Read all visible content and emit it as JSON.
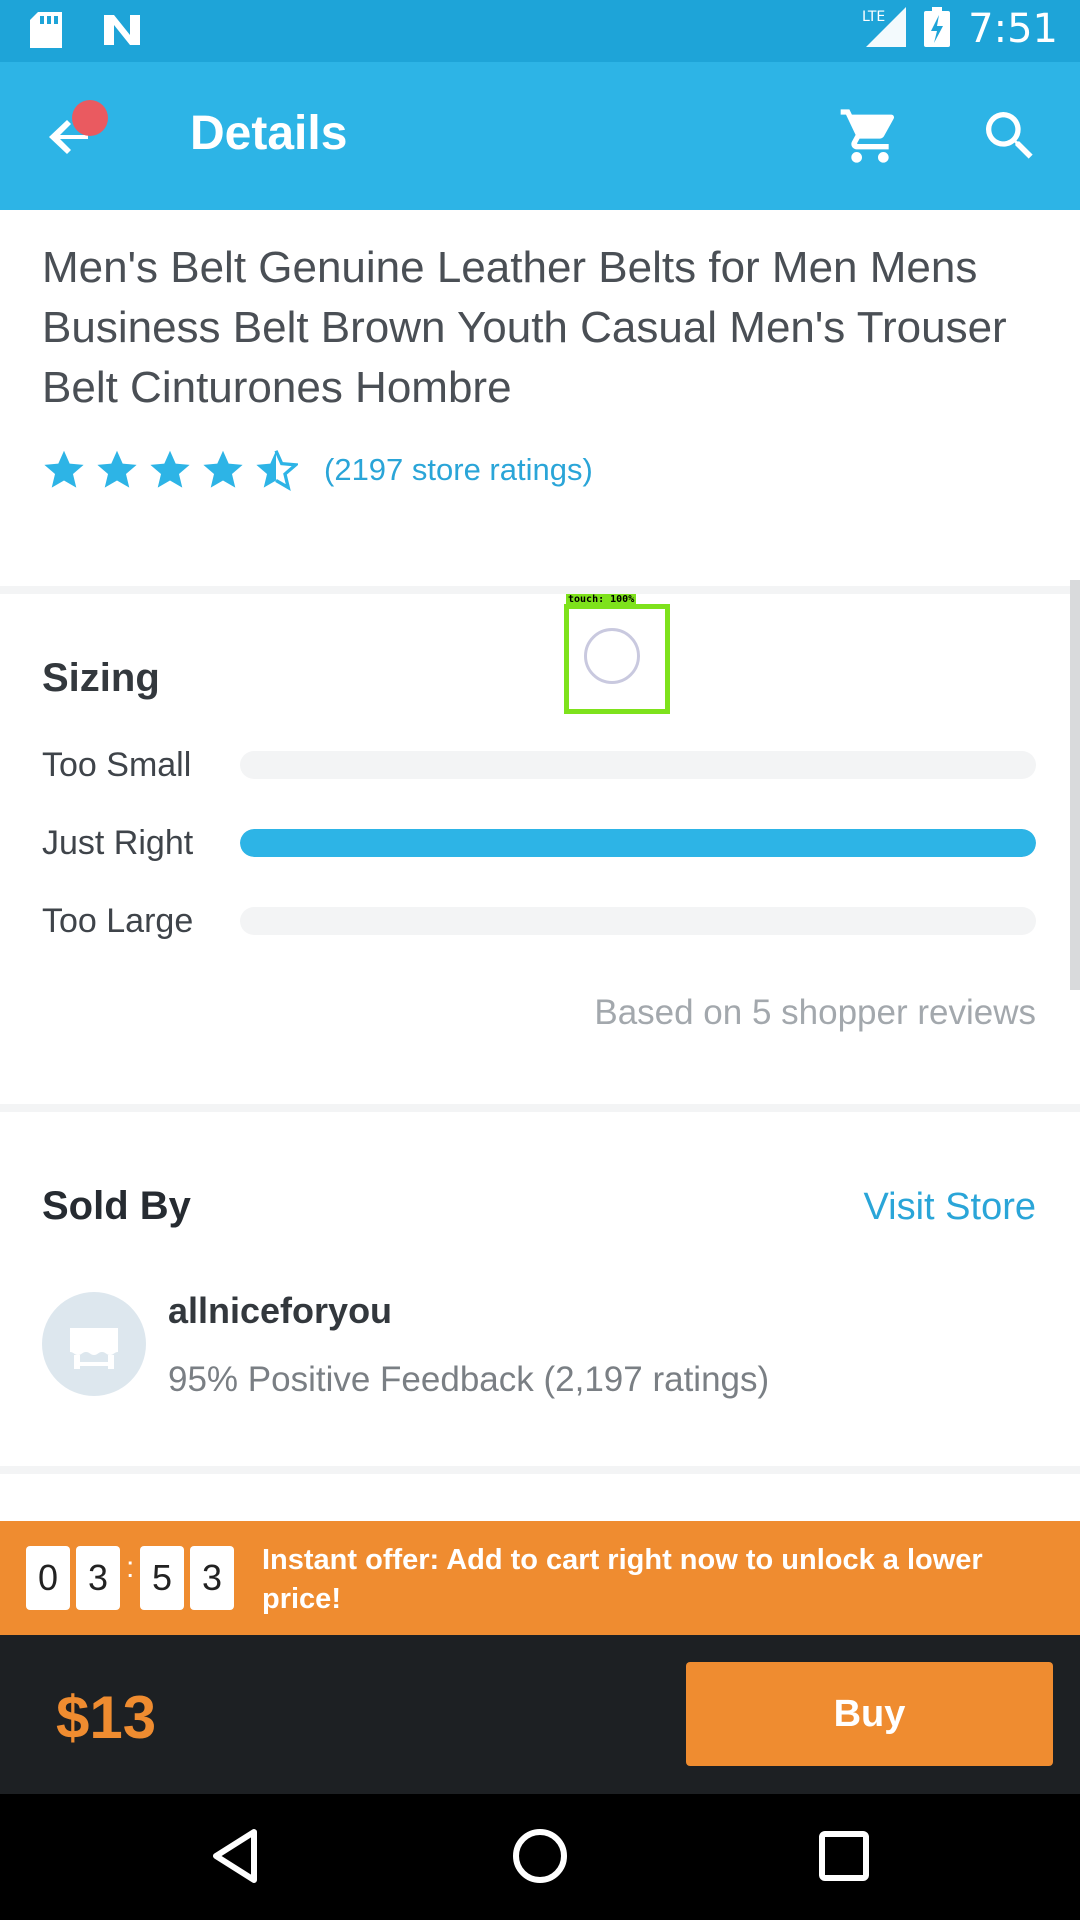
{
  "status_bar": {
    "time": "7:51",
    "network_label": "LTE",
    "icons": [
      "sd-card-icon",
      "n-notification-icon",
      "signal-icon",
      "battery-charging-icon"
    ]
  },
  "app_bar": {
    "title": "Details",
    "icons": [
      "back-arrow-icon",
      "cart-icon",
      "search-icon"
    ],
    "accent_color": "#2db4e6"
  },
  "product": {
    "title": "Men's Belt Genuine Leather Belts for Men Mens Business Belt Brown Youth Casual Men's Trouser Belt Cinturones Hombre",
    "rating_stars": 4.5,
    "rating_text": "(2197 store ratings)"
  },
  "sizing": {
    "title": "Sizing",
    "rows": [
      {
        "label": "Too Small",
        "fraction": 0.0
      },
      {
        "label": "Just Right",
        "fraction": 1.0
      },
      {
        "label": "Too Large",
        "fraction": 0.0
      }
    ],
    "based_on": "Based on 5 shopper reviews"
  },
  "touch_indicator": {
    "label": "touch: 100%"
  },
  "seller": {
    "title": "Sold By",
    "visit_store": "Visit Store",
    "name": "allniceforyou",
    "feedback": "95% Positive Feedback (2,197 ratings)",
    "avatar_icon": "storefront-icon"
  },
  "offer": {
    "timer_digits": [
      "0",
      "3",
      "5",
      "3"
    ],
    "separator": ":",
    "text": "Instant offer: Add to cart right now to unlock a lower price!",
    "color": "#ef8c30"
  },
  "purchase": {
    "price": "$13",
    "buy_label": "Buy"
  },
  "nav_bar": {
    "icons": [
      "back-triangle-icon",
      "home-circle-icon",
      "recents-square-icon"
    ]
  }
}
